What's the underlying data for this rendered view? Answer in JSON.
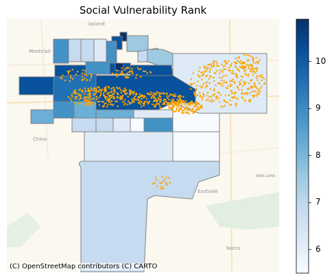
{
  "map": {
    "title": "Social Vulnerability Rank",
    "attribution": "(C) OpenStreetMap contributors (C) CARTO",
    "basemap_labels": [
      "Upland",
      "Montclair",
      "Chino",
      "Eastvale",
      "Norco",
      "MIRA LOMA"
    ]
  },
  "colorbar": {
    "min": 5.5,
    "max": 10.9,
    "ticks": [
      "6",
      "7",
      "8",
      "9",
      "10"
    ],
    "tick_values": [
      6,
      7,
      8,
      9,
      10
    ],
    "colormap": "Blues",
    "color_low": "#f7fbff",
    "color_high": "#08306b"
  },
  "style": {
    "point_color": "#ffa500",
    "boundary_color": "#808080",
    "basemap_color": "#fbf8f0"
  }
}
